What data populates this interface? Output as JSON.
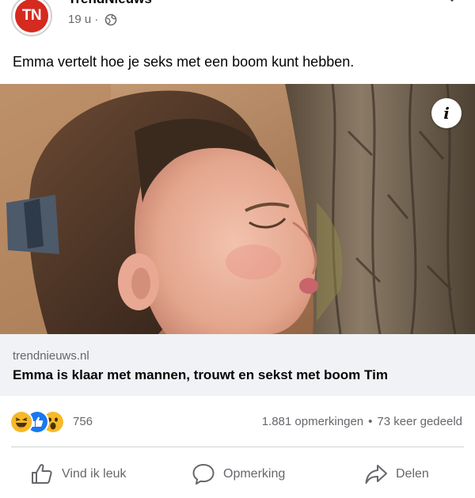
{
  "post": {
    "page_name": "TrendNieuws",
    "avatar_text": "TN",
    "time": "19 u",
    "separator": "·",
    "caption": "Emma vertelt hoe je seks met een boom kunt hebben."
  },
  "link_preview": {
    "domain": "trendnieuws.nl",
    "title": "Emma is klaar met mannen, trouwt en sekst met boom Tim",
    "info_symbol": "i"
  },
  "engagement": {
    "reaction_icons": [
      "haha",
      "like",
      "wow"
    ],
    "reaction_count": "756",
    "comments": "1.881 opmerkingen",
    "dot": "•",
    "shares": "73 keer gedeeld"
  },
  "actions": {
    "like": "Vind ik leuk",
    "comment": "Opmerking",
    "share": "Delen"
  },
  "colors": {
    "brand_red": "#d42a1f",
    "like_blue": "#1877f2",
    "reaction_yellow": "#f7b928",
    "secondary_text": "#65676b",
    "link_bg": "#f0f2f5"
  }
}
